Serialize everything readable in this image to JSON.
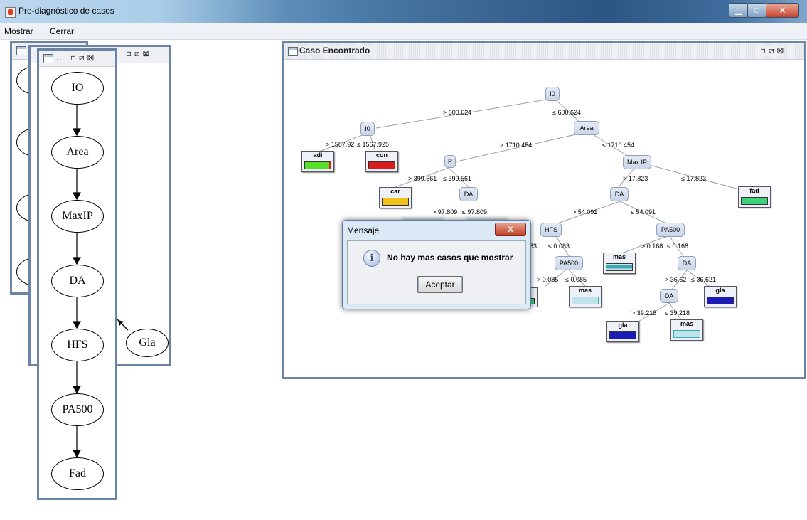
{
  "window": {
    "title": "Pre-diagnóstico de casos",
    "minimize": "▁",
    "maximize": "□",
    "close": "X"
  },
  "menu": {
    "items": [
      "Mostrar",
      "Cerrar"
    ]
  },
  "frames": {
    "back_controls": "▫ ⧄ ⊠",
    "front_title": "...",
    "front_controls": "▫ ⧄ ⊠",
    "graph_nodes": [
      "IO",
      "Area",
      "MaxIP",
      "DA",
      "HFS",
      "PA500",
      "Fad"
    ],
    "side_node": "Gla",
    "case_title": "Caso Encontrado",
    "case_controls": "▫ ⧄ ⊠"
  },
  "tree": {
    "nodes": {
      "root": "I0",
      "io2": "I0",
      "area": "Area",
      "p": "P",
      "maxip": "Max IP",
      "da1": "DA",
      "da2": "DA",
      "hfs": "HFS",
      "pa500a": "PA500",
      "pa500b": "PA500",
      "da3": "DA",
      "da4": "DA"
    },
    "leaves": {
      "adi": "adi",
      "con": "con",
      "car": "car",
      "fad": "fad",
      "mas1": "mas",
      "mas2": "mas",
      "mas3": "mas",
      "gla1": "gla",
      "gla2": "gla"
    },
    "edges": {
      "e1": "> 600.624",
      "e2": "≤ 600.624",
      "e3": "> 1567.92",
      "e4": "≤ 1567.925",
      "e5": "> 1710.454",
      "e6": "≤ 1710.454",
      "e7": "> 399.561",
      "e8": "≤ 399.561",
      "e9": "> 17.823",
      "e10": "≤ 17.823",
      "e11": "> 97.809",
      "e12": "≤ 97.809",
      "e13": "> 54.091",
      "e14": "≤ 54.091",
      "e15": "83",
      "e16": "≤ 0.083",
      "e17": "> 0.168",
      "e18": "≤ 0.168",
      "e19": "> 0.085",
      "e20": "≤ 0.085",
      "e21": "> 36.62",
      "e22": "≤ 36.621",
      "e23": "> 39.218",
      "e24": "≤ 39.218"
    }
  },
  "dialog": {
    "title": "Mensaje",
    "message": "No hay mas casos que mostrar",
    "ok": "Aceptar",
    "close": "X",
    "icon": "i"
  },
  "colors": {
    "adi": "#55e02a",
    "con": "#d91c1c",
    "car": "#f2c21a",
    "fad": "#3fd07a",
    "mas": "#3aa7b8",
    "gla": "#1b1bb5"
  }
}
